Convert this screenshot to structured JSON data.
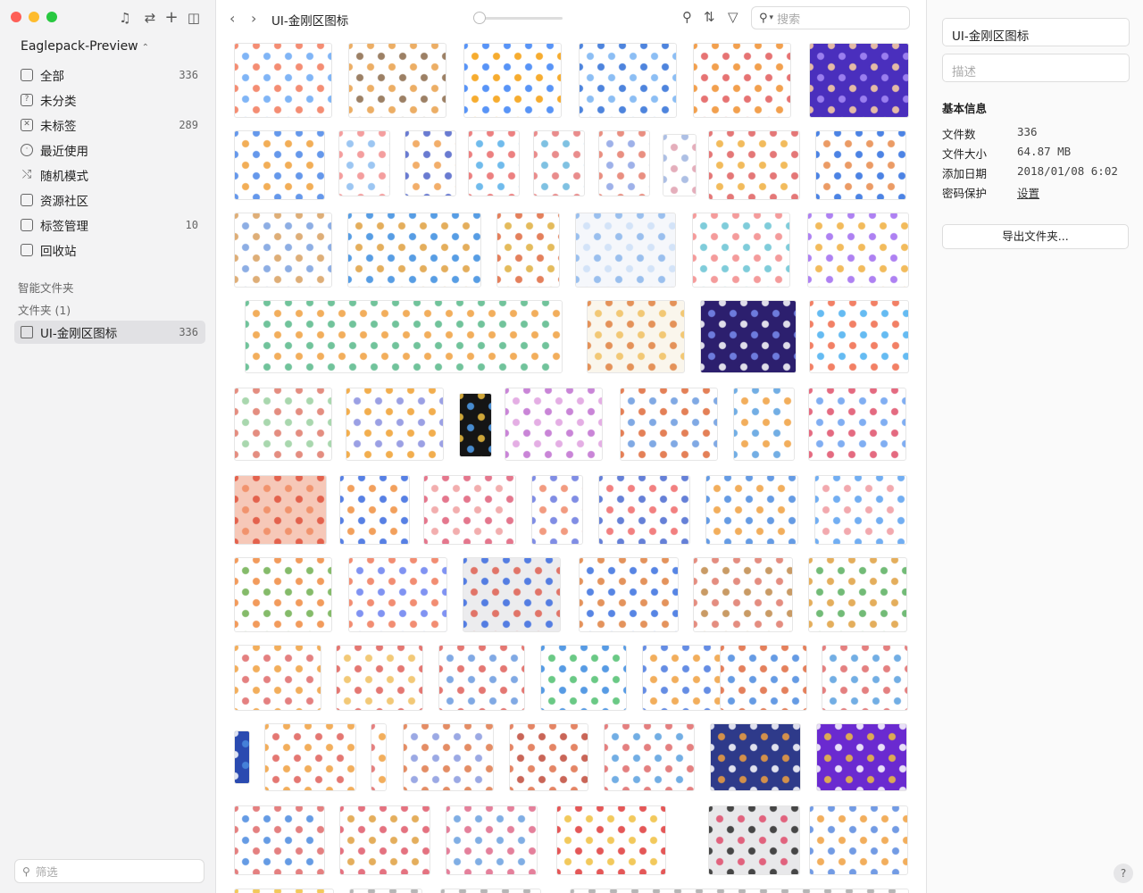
{
  "window": {
    "library": "Eaglepack-Preview",
    "library_chevron": "⌃"
  },
  "sidebar": {
    "items": [
      {
        "label": "全部",
        "count": "336",
        "icon": "inbox-icon"
      },
      {
        "label": "未分类",
        "count": "",
        "icon": "question-icon"
      },
      {
        "label": "未标签",
        "count": "289",
        "icon": "no-tag-icon"
      },
      {
        "label": "最近使用",
        "count": "",
        "icon": "clock-icon"
      },
      {
        "label": "随机模式",
        "count": "",
        "icon": "shuffle-icon"
      },
      {
        "label": "资源社区",
        "count": "",
        "icon": "community-icon"
      },
      {
        "label": "标签管理",
        "count": "10",
        "icon": "bookmark-icon"
      },
      {
        "label": "回收站",
        "count": "",
        "icon": "trash-icon"
      }
    ],
    "smart_folders": "智能文件夹",
    "folders": "文件夹 (1)",
    "folder": {
      "label": "UI-金刚区图标",
      "count": "336"
    },
    "filter_placeholder": "筛选"
  },
  "toolbar": {
    "title": "UI-金刚区图标",
    "search_placeholder": "搜索"
  },
  "inspector": {
    "name": "UI-金刚区图标",
    "desc_placeholder": "描述",
    "section": "基本信息",
    "props": [
      {
        "k": "文件数",
        "v": "336"
      },
      {
        "k": "文件大小",
        "v": "64.87 MB"
      },
      {
        "k": "添加日期",
        "v": "2018/01/08 6:02"
      },
      {
        "k": "密码保护",
        "v": "设置"
      }
    ],
    "export": "导出文件夹...",
    "help": "?"
  },
  "colors": {
    "sidebar_bg": "#f3f3f4",
    "selected": "#e1e1e4",
    "traffic_red": "#fe5f57",
    "traffic_yellow": "#febc2e",
    "traffic_green": "#28c840"
  },
  "thumbnails": [
    [
      "#f2795b",
      "#6aa8f5",
      "#fff"
    ],
    [
      "#e9a04b",
      "#8b6a4b",
      "#fff"
    ],
    [
      "#3b82f6",
      "#f59e0b",
      "#fff"
    ],
    [
      "#2f6fd8",
      "#78b3f2",
      "#fff"
    ],
    [
      "#f0902f",
      "#e25b5b",
      "#fff"
    ],
    [
      "#ffd3a3",
      "#a98cf8",
      "#4a2fbd"
    ],
    [
      "#4b86e8",
      "#f0a03a",
      "#fff"
    ],
    [
      "#f28d8d",
      "#8bbdf0",
      "#fff"
    ],
    [
      "#4f64c9",
      "#f0a050",
      "#fff"
    ],
    [
      "#e96a6a",
      "#57b0e9",
      "#fff"
    ],
    [
      "#e67878",
      "#69b7dd",
      "#fff"
    ],
    [
      "#e67c6c",
      "#8da4e6",
      "#fff"
    ],
    [
      "#9fb4e0",
      "#e0a0b0",
      "#fff"
    ],
    [
      "#e06060",
      "#f0b040",
      "#fff"
    ],
    [
      "#2d6ee0",
      "#e88a4a",
      "#fff"
    ],
    [
      "#d9a060",
      "#7aa0e0",
      "#fff"
    ],
    [
      "#3a8ce0",
      "#e0a040",
      "#fff"
    ],
    [
      "#e06a40",
      "#e0b040",
      "#fff"
    ],
    [
      "#8ab6ec",
      "#cde0f7",
      "#f5f7fb"
    ],
    [
      "#f28a8a",
      "#69c4d4",
      "#fff"
    ],
    [
      "#a06cf0",
      "#f0b040",
      "#fff"
    ],
    [
      "#59b98a",
      "#f0a040",
      "#fff"
    ],
    [
      "#e08040",
      "#f0c060",
      "#faf6ec"
    ],
    [
      "#ffffff",
      "#7a8cf0",
      "#2c1f6e"
    ],
    [
      "#f06a4a",
      "#4ab0f0",
      "#fff"
    ],
    [
      "#e07a6a",
      "#9ad0a0",
      "#fff"
    ],
    [
      "#f0a030",
      "#8a90e0",
      "#fff"
    ],
    [
      "#f0c040",
      "#50a0f0",
      "#151515"
    ],
    [
      "#c070d0",
      "#e0a0e0",
      "#fff"
    ],
    [
      "#e06a3a",
      "#6a9ae0",
      "#fff"
    ],
    [
      "#5aa0e0",
      "#f0a040",
      "#fff"
    ],
    [
      "#e0506a",
      "#6aa0f0",
      "#fff"
    ],
    [
      "#e0503a",
      "#f08a60",
      "#f6c8b8"
    ],
    [
      "#3a6ae0",
      "#f09040",
      "#fff"
    ],
    [
      "#e0607a",
      "#f0a0a0",
      "#fff"
    ],
    [
      "#6a7ae0",
      "#f08a6a",
      "#fff"
    ],
    [
      "#4a6ad0",
      "#f06a6a",
      "#fff"
    ],
    [
      "#4a8ae0",
      "#f0a040",
      "#fff"
    ],
    [
      "#5aa0f0",
      "#f09aa0",
      "#fff"
    ],
    [
      "#f08a40",
      "#70b050",
      "#fff"
    ],
    [
      "#f07a5a",
      "#6a80f0",
      "#fff"
    ],
    [
      "#3a6ae0",
      "#e06050",
      "#ececee"
    ],
    [
      "#e08040",
      "#3a70e0",
      "#fff"
    ],
    [
      "#e07a6a",
      "#c08a4a",
      "#fff"
    ],
    [
      "#e0a040",
      "#5ab060",
      "#fff"
    ],
    [
      "#f0a040",
      "#e06a6a",
      "#fff"
    ],
    [
      "#e0605a",
      "#f0c060",
      "#fff"
    ],
    [
      "#e0605a",
      "#6a9ae0",
      "#fff"
    ],
    [
      "#3a8ae0",
      "#50c070",
      "#fff"
    ],
    [
      "#4a7ae0",
      "#f0a040",
      "#fff"
    ],
    [
      "#e06a40",
      "#4a8ae0",
      "#fff"
    ],
    [
      "#e06a6a",
      "#5aa0e0",
      "#fff"
    ],
    [
      "#ffffff",
      "#4a8ae0",
      "#2a4ab0"
    ],
    [
      "#f0a040",
      "#e0605a",
      "#fff"
    ],
    [
      "#e06a6a",
      "#f0a040",
      "#fff"
    ],
    [
      "#e07a4a",
      "#8a9ae0",
      "#fff"
    ],
    [
      "#e0704a",
      "#c04a3a",
      "#fff"
    ],
    [
      "#e06a6a",
      "#5aa0e0",
      "#fff"
    ],
    [
      "#ffffff",
      "#f0a040",
      "#2e3a8a"
    ],
    [
      "#ffffff",
      "#f0c040",
      "#6a2ad0"
    ],
    [
      "#e06a6a",
      "#4a8ae0",
      "#fff"
    ],
    [
      "#e05a6a",
      "#e0a040",
      "#fff"
    ],
    [
      "#e06a8a",
      "#6aa0e0",
      "#fff"
    ],
    [
      "#e03a3a",
      "#f0c040",
      "#fff"
    ],
    [
      "#2a2a2a",
      "#e04a6a",
      "#e8e8ea"
    ],
    [
      "#5a8ae0",
      "#f0a040",
      "#fff"
    ],
    [
      "#f0c040",
      "#fff",
      "#fff"
    ],
    [
      "#aaaaaa",
      "#ccc",
      "#fff"
    ],
    [
      "#aaaaaa",
      "#ccc",
      "#fff"
    ],
    [
      "#aaaaaa",
      "#ccc",
      "#fff"
    ]
  ]
}
